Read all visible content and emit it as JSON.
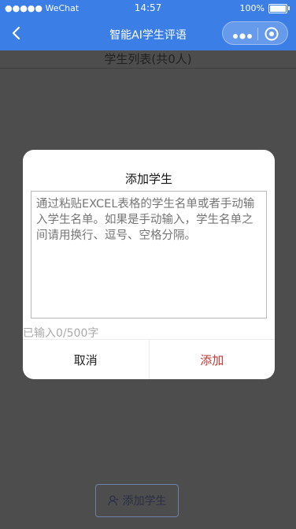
{
  "status_bar": {
    "carrier": "●●●●● WeChat",
    "time": "14:57",
    "battery": "100%"
  },
  "nav": {
    "title": "智能AI学生评语"
  },
  "page": {
    "header": "学生列表(共0人)",
    "add_button_label": "添加学生"
  },
  "modal": {
    "title": "添加学生",
    "placeholder": "通过粘贴EXCEL表格的学生名单或者手动输入学生名单。如果是手动输入，学生名单之间请用换行、逗号、空格分隔。",
    "counter": "已输入0/500字",
    "cancel_label": "取消",
    "confirm_label": "添加"
  },
  "colors": {
    "nav_bg": "#3b7ee6",
    "confirm": "#c23531",
    "overlay": "#4d4d4d"
  },
  "icons": [
    "wifi-icon",
    "battery-icon",
    "back-icon",
    "more-icon",
    "close-circle-icon",
    "user-icon"
  ]
}
